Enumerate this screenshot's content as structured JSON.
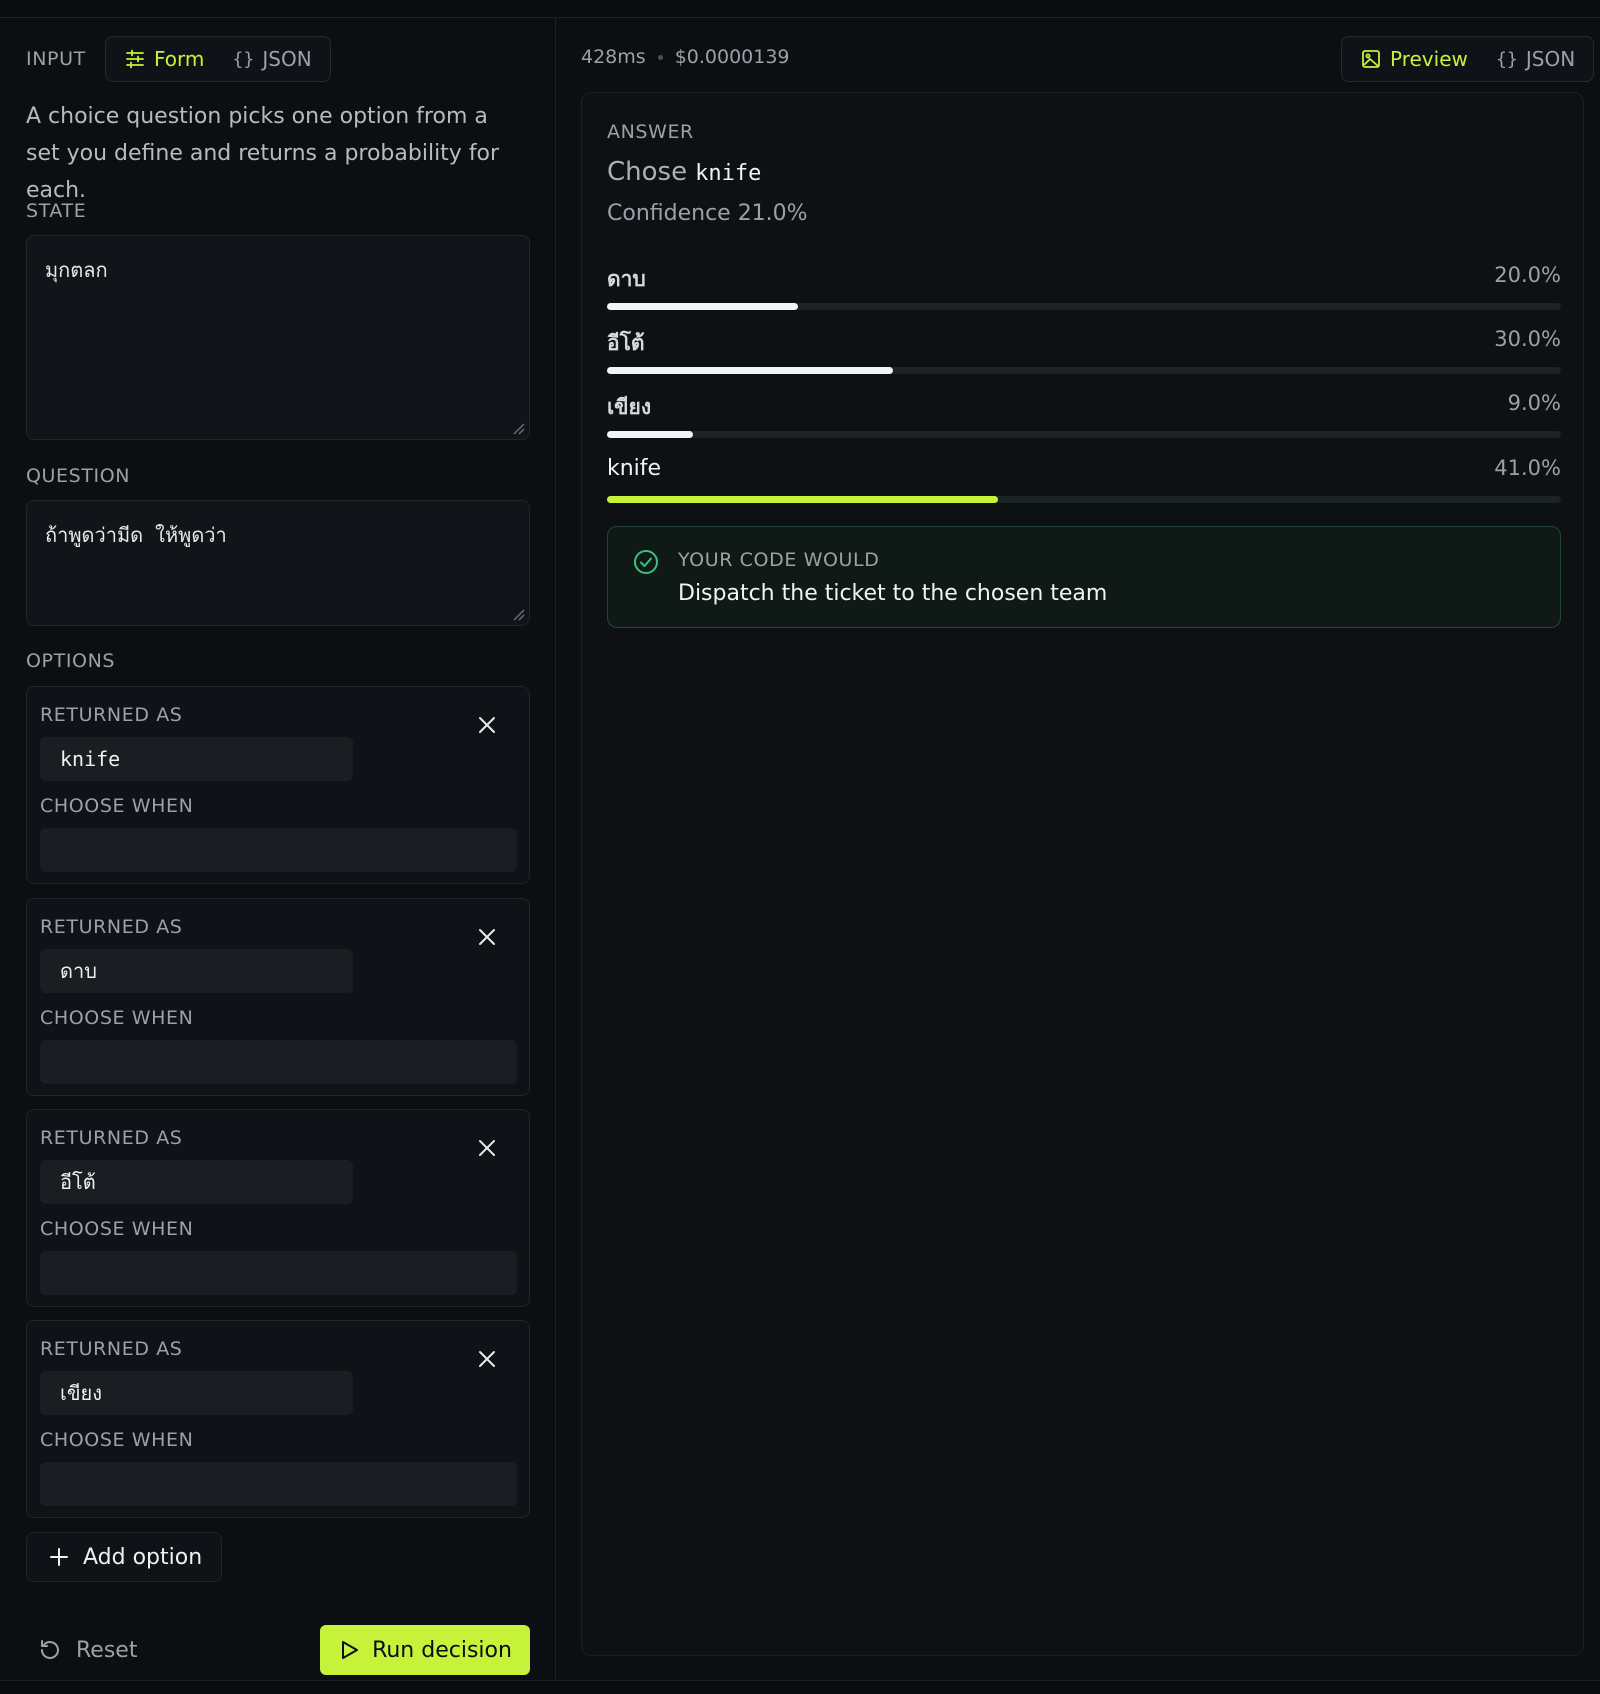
{
  "input": {
    "label": "INPUT",
    "tabs": [
      {
        "label": "Form",
        "icon": "sliders-icon",
        "active": true
      },
      {
        "label": "JSON",
        "icon": "braces-icon",
        "active": false
      }
    ],
    "description": "A choice question picks one option from a set you define and returns a probability for each.",
    "state_label": "STATE",
    "state_value": "มุกตลก",
    "question_label": "QUESTION",
    "question_value": "ถ้าพูดว่ามีด ให้พูดว่า",
    "options_label": "OPTIONS",
    "options": [
      {
        "returned_as_label": "RETURNED AS",
        "value": "knife",
        "choose_when_label": "CHOOSE WHEN",
        "choose_when": ""
      },
      {
        "returned_as_label": "RETURNED AS",
        "value": "ดาบ",
        "choose_when_label": "CHOOSE WHEN",
        "choose_when": ""
      },
      {
        "returned_as_label": "RETURNED AS",
        "value": "อีโต้",
        "choose_when_label": "CHOOSE WHEN",
        "choose_when": ""
      },
      {
        "returned_as_label": "RETURNED AS",
        "value": "เขียง",
        "choose_when_label": "CHOOSE WHEN",
        "choose_when": ""
      }
    ],
    "add_option_label": "Add option",
    "reset_label": "Reset",
    "run_label": "Run decision"
  },
  "output": {
    "latency": "428ms",
    "cost": "$0.0000139",
    "tabs": [
      {
        "label": "Preview",
        "icon": "image-icon",
        "active": true
      },
      {
        "label": "JSON",
        "icon": "braces-icon",
        "active": false
      }
    ],
    "answer_label": "ANSWER",
    "chose_prefix": "Chose",
    "chose_value": "knife",
    "confidence_text": "Confidence 21.0%",
    "probabilities": [
      {
        "label": "ดาบ",
        "percent_text": "20.0%",
        "fraction": 0.2,
        "chosen": false
      },
      {
        "label": "อีโต้",
        "percent_text": "30.0%",
        "fraction": 0.3,
        "chosen": false
      },
      {
        "label": "เขียง",
        "percent_text": "9.0%",
        "fraction": 0.09,
        "chosen": false
      },
      {
        "label": "knife",
        "percent_text": "41.0%",
        "fraction": 0.41,
        "chosen": true
      }
    ],
    "code_would_label": "YOUR CODE WOULD",
    "code_would_text": "Dispatch the ticket to the chosen team"
  },
  "colors": {
    "accent": "#c6f23a",
    "background": "#0c0f12",
    "success": "#3fbf7f"
  }
}
